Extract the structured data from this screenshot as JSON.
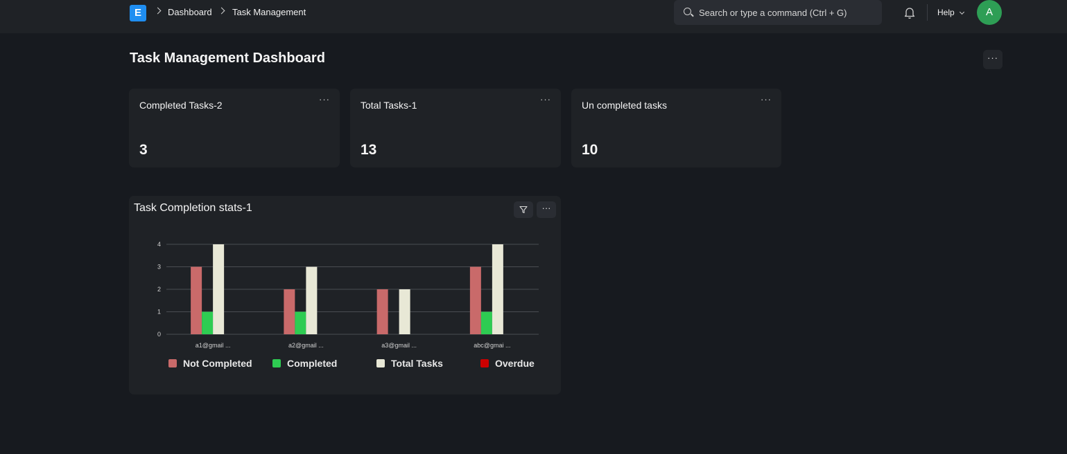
{
  "navbar": {
    "logo_letter": "E",
    "breadcrumbs": [
      "Dashboard",
      "Task Management"
    ],
    "search_placeholder": "Search or type a command (Ctrl + G)",
    "help_label": "Help",
    "avatar_initial": "A"
  },
  "page": {
    "title": "Task Management Dashboard",
    "menu_label": "···"
  },
  "cards": [
    {
      "title": "Completed Tasks-2",
      "value": "3",
      "menu": "···"
    },
    {
      "title": "Total Tasks-1",
      "value": "13",
      "menu": "···"
    },
    {
      "title": "Un completed tasks",
      "value": "10",
      "menu": "···"
    }
  ],
  "chart_card": {
    "title": "Task Completion stats-1",
    "menu_label": "···"
  },
  "colors": {
    "not_completed": "#c96a6a",
    "completed": "#2ecc52",
    "total": "#e8e8d6",
    "overdue": "#cc0000"
  },
  "chart_data": {
    "type": "bar",
    "categories": [
      "a1@gmail ...",
      "a2@gmail ...",
      "a3@gmail ...",
      "abc@gmai ..."
    ],
    "series": [
      {
        "name": "Not Completed",
        "values": [
          3,
          2,
          2,
          3
        ]
      },
      {
        "name": "Completed",
        "values": [
          1,
          1,
          0,
          1
        ]
      },
      {
        "name": "Total Tasks",
        "values": [
          4,
          3,
          2,
          4
        ]
      },
      {
        "name": "Overdue",
        "values": [
          0,
          0,
          0,
          0
        ]
      }
    ],
    "yticks": [
      "0",
      "1",
      "2",
      "3",
      "4"
    ],
    "ylim": [
      0,
      4
    ],
    "grid": true,
    "legend": "bottom"
  }
}
